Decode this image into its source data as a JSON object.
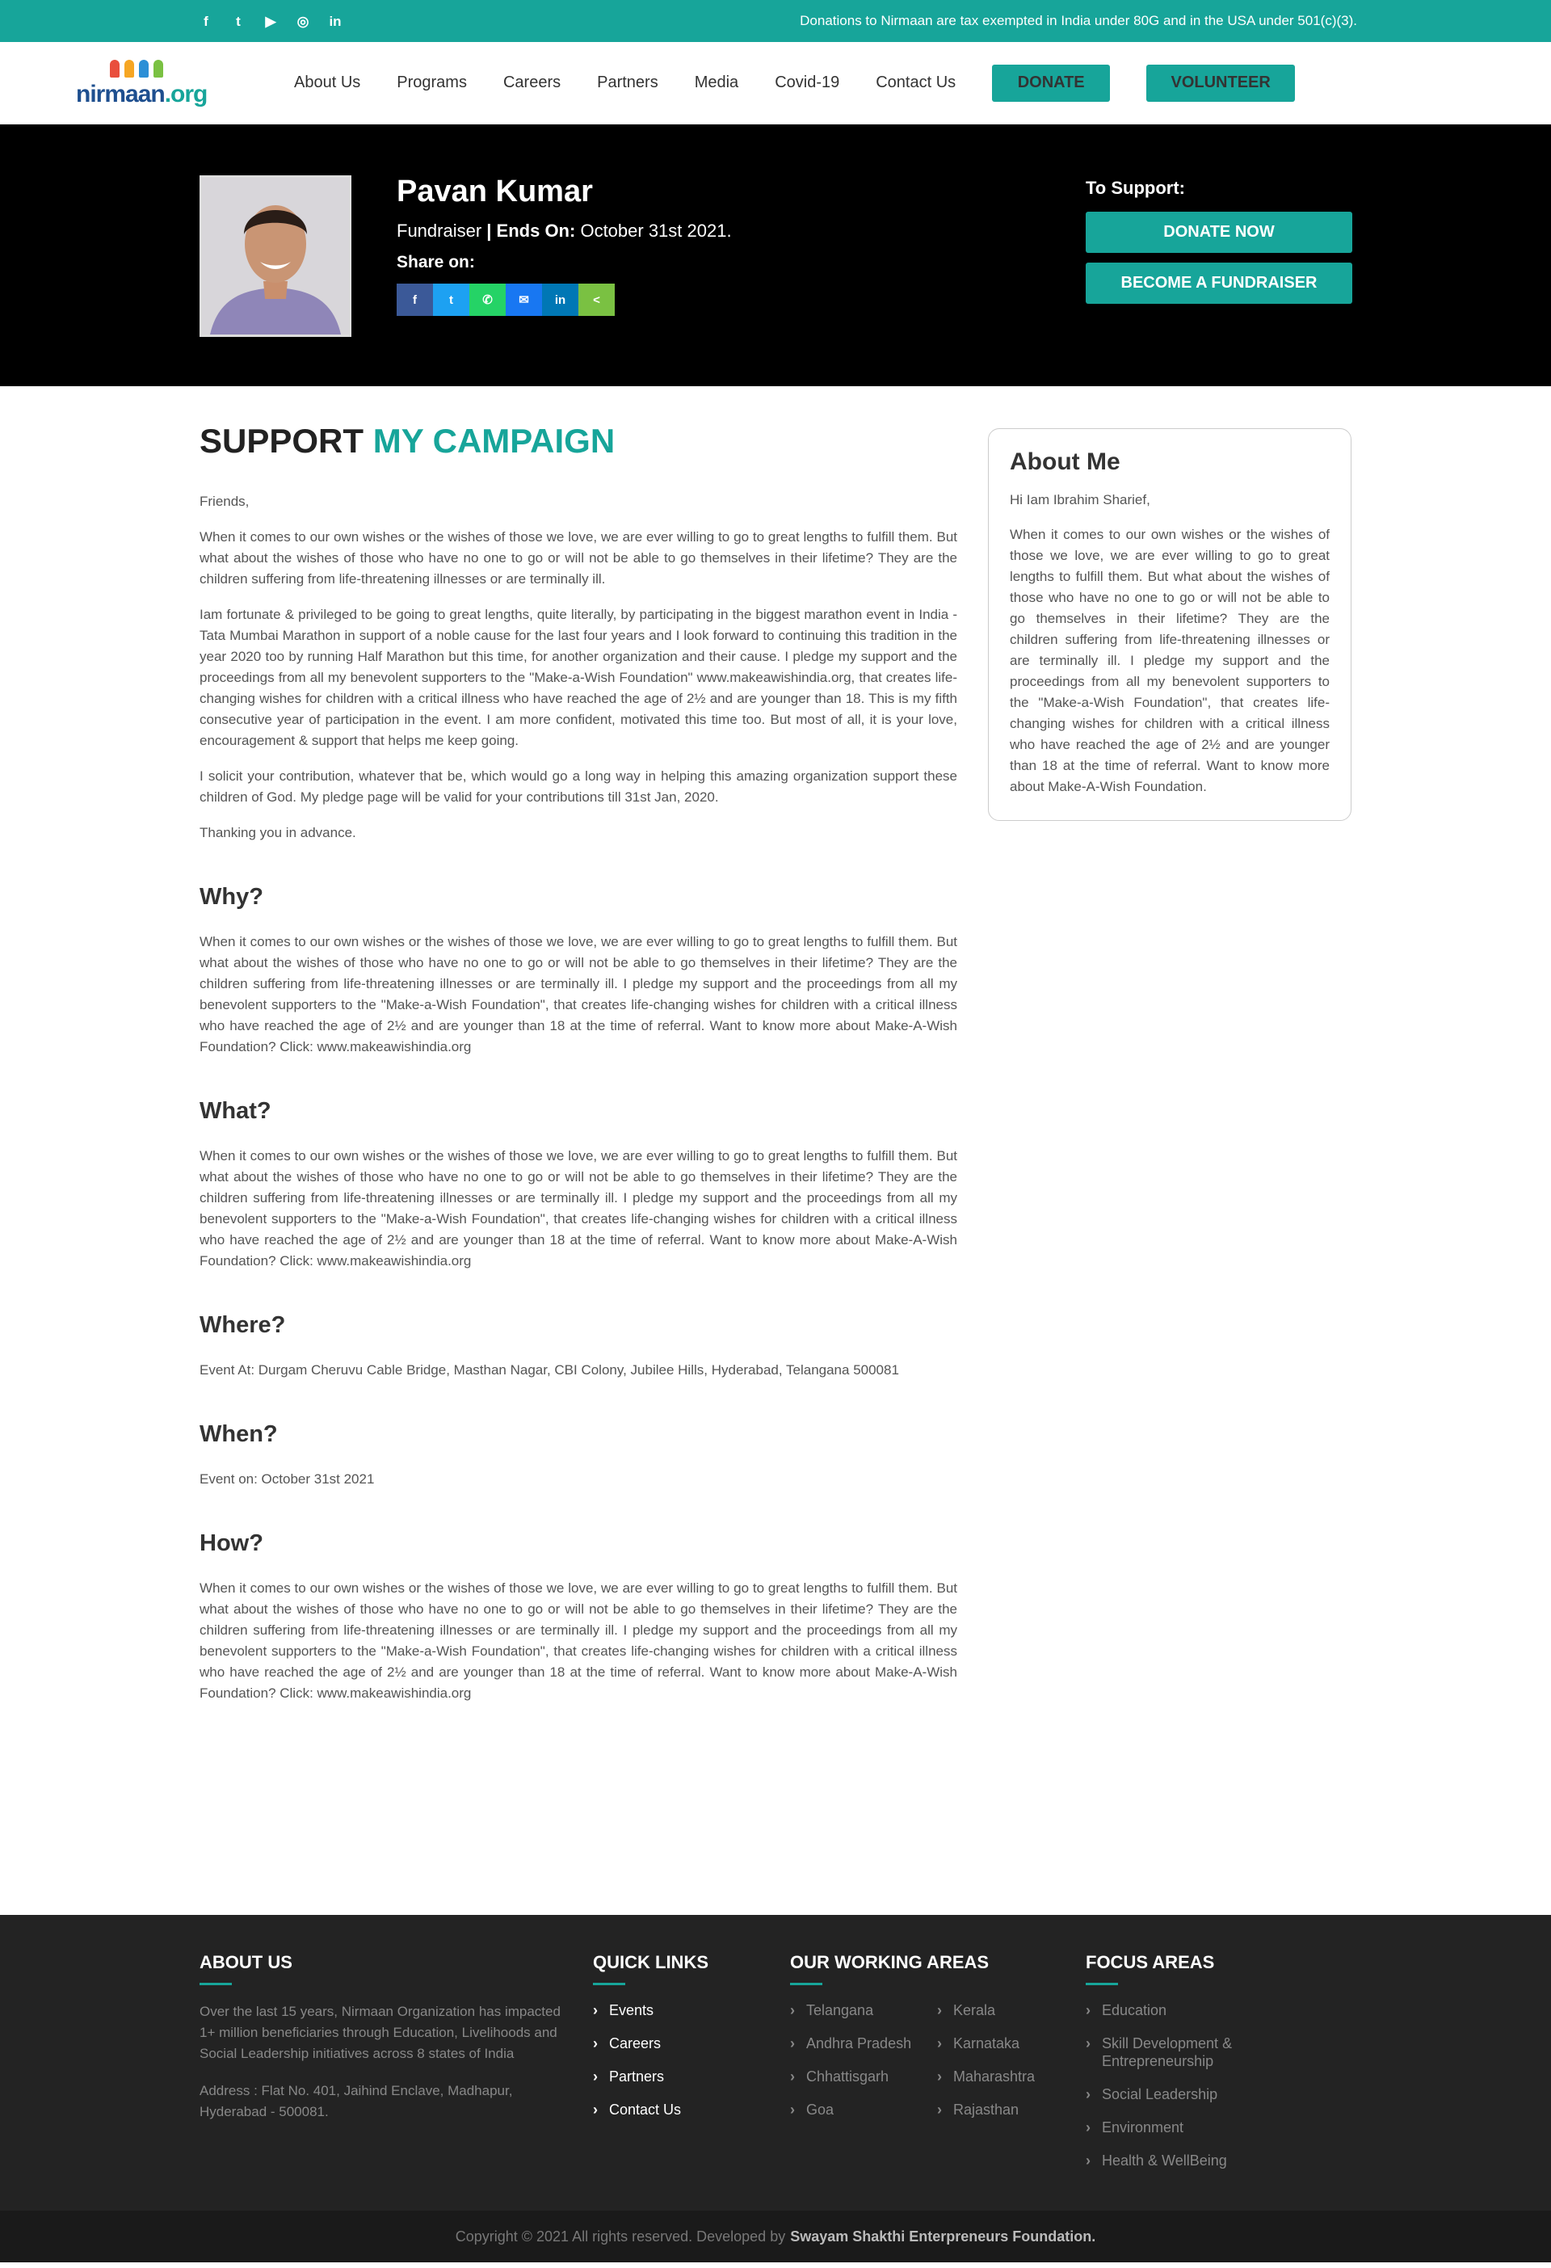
{
  "topbar": {
    "social": [
      {
        "icon": "facebook-icon",
        "glyph": "f"
      },
      {
        "icon": "twitter-icon",
        "glyph": "t"
      },
      {
        "icon": "youtube-icon",
        "glyph": "▶"
      },
      {
        "icon": "instagram-icon",
        "glyph": "◎"
      },
      {
        "icon": "linkedin-icon",
        "glyph": "in"
      }
    ],
    "note": "Donations to Nirmaan are tax exempted in India under 80G and in the USA under 501(c)(3)."
  },
  "header": {
    "logo_main": "nirmaan",
    "logo_suffix": ".org",
    "nav": [
      "About Us",
      "Programs",
      "Careers",
      "Partners",
      "Media",
      "Covid-19",
      "Contact Us"
    ],
    "donate_label": "DONATE",
    "volunteer_label": "VOLUNTEER"
  },
  "hero": {
    "name": "Pavan Kumar",
    "role": "Fundraiser",
    "ends_label": "| Ends On:",
    "ends_date": "October 31st 2021.",
    "share_label": "Share on:",
    "share_buttons": [
      {
        "icon": "facebook-share-icon",
        "glyph": "f",
        "color": "#3b5998"
      },
      {
        "icon": "twitter-share-icon",
        "glyph": "t",
        "color": "#1da1f2"
      },
      {
        "icon": "whatsapp-share-icon",
        "glyph": "✆",
        "color": "#25d366"
      },
      {
        "icon": "messenger-share-icon",
        "glyph": "✉",
        "color": "#1877f2"
      },
      {
        "icon": "linkedin-share-icon",
        "glyph": "in",
        "color": "#0077b5"
      },
      {
        "icon": "share-icon",
        "glyph": "<",
        "color": "#7ac142"
      }
    ],
    "support_label": "To Support:",
    "donate_now_label": "DONATE NOW",
    "fundraiser_label": "BECOME A FUNDRAISER"
  },
  "campaign": {
    "title_plain": "SUPPORT",
    "title_accent": "MY CAMPAIGN",
    "greeting": "Friends,",
    "p1": "When it comes to our own wishes or the wishes of those we love, we are ever willing to go to great lengths to fulfill them. But what about the wishes of those who have no one to go or will not be able to go themselves in their lifetime? They are the children suffering from life-threatening illnesses or are terminally ill.",
    "p2": "Iam fortunate & privileged to be going to great lengths, quite literally, by participating in the biggest marathon event in India -Tata Mumbai Marathon in support of a noble cause for the last four years and I look forward to continuing this tradition in the year 2020 too by running Half Marathon but this time, for another organization and their cause. I pledge my support and the proceedings from all my benevolent supporters to the \"Make-a-Wish Foundation\" www.makeawishindia.org, that creates life-changing wishes for children with a critical illness who have reached the age of 2½ and are younger than 18. This is my fifth consecutive year of participation in the event. I am more confident, motivated this time too. But most of all, it is your love, encouragement & support that helps me keep going.",
    "p3": "I solicit your contribution, whatever that be, which would go a long way in helping this amazing organization support these children of God. My pledge page will be valid for your contributions till 31st Jan, 2020.",
    "p4": "Thanking you in advance.",
    "why_title": "Why?",
    "why_body": "When it comes to our own wishes or the wishes of those we love, we are ever willing to go to great lengths to fulfill them. But what about the wishes of those who have no one to go or will not be able to go themselves in their lifetime? They are the children suffering from life-threatening illnesses or are terminally ill. I pledge my support and the proceedings from all my benevolent supporters to the \"Make-a-Wish Foundation\", that creates life-changing wishes for children with a critical illness who have reached the age of 2½ and are younger than 18 at the time of referral. Want to know more about Make-A-Wish Foundation? Click: www.makeawishindia.org",
    "what_title": "What?",
    "what_body": "When it comes to our own wishes or the wishes of those we love, we are ever willing to go to great lengths to fulfill them. But what about the wishes of those who have no one to go or will not be able to go themselves in their lifetime? They are the children suffering from life-threatening illnesses or are terminally ill. I pledge my support and the proceedings from all my benevolent supporters to the \"Make-a-Wish Foundation\", that creates life-changing wishes for children with a critical illness who have reached the age of 2½ and are younger than 18 at the time of referral. Want to know more about Make-A-Wish Foundation? Click: www.makeawishindia.org",
    "where_title": "Where?",
    "where_body": "Event At: Durgam Cheruvu Cable Bridge, Masthan Nagar, CBI Colony, Jubilee Hills, Hyderabad, Telangana 500081",
    "when_title": "When?",
    "when_body": "Event on: October 31st 2021",
    "how_title": "How?",
    "how_body": "When it comes to our own wishes or the wishes of those we love, we are ever willing to go to great lengths to fulfill them. But what about the wishes of those who have no one to go or will not be able to go themselves in their lifetime? They are the children suffering from life-threatening illnesses or are terminally ill. I pledge my support and the proceedings from all my benevolent supporters to the \"Make-a-Wish Foundation\", that creates life-changing wishes for children with a critical illness who have reached the age of 2½ and are younger than 18 at the time of referral. Want to know more about Make-A-Wish Foundation? Click: www.makeawishindia.org"
  },
  "about_me": {
    "title": "About Me",
    "greeting": "Hi Iam Ibrahim Sharief,",
    "body": "When it comes to our own wishes or the wishes of those we love, we are ever willing to go to great lengths to fulfill them. But what about the wishes of those who have no one to go or will not be able to go themselves in their lifetime? They are the children suffering from life-threatening illnesses or are terminally ill. I pledge my support and the proceedings from all my benevolent supporters to the \"Make-a-Wish Foundation\", that creates life-changing wishes for children with a critical illness who have reached the age of 2½ and are younger than 18 at the time of referral. Want to know more about Make-A-Wish Foundation."
  },
  "footer": {
    "about_title": "ABOUT US",
    "about_text": "Over the last 15 years, Nirmaan Organization has impacted 1+ million beneficiaries through Education, Livelihoods and Social Leadership initiatives across 8 states of India",
    "address": "Address : Flat No. 401, Jaihind Enclave, Madhapur, Hyderabad - 500081.",
    "links_title": "QUICK LINKS",
    "links": [
      "Events",
      "Careers",
      "Partners",
      "Contact Us"
    ],
    "areas_title": "OUR WORKING AREAS",
    "areas_col1": [
      "Telangana",
      "Andhra Pradesh",
      "Chhattisgarh",
      "Goa"
    ],
    "areas_col2": [
      "Kerala",
      "Karnataka",
      "Maharashtra",
      "Rajasthan"
    ],
    "focus_title": "FOCUS AREAS",
    "focus": [
      "Education",
      "Skill Development & Entrepreneurship",
      "Social Leadership",
      "Environment",
      "Health & WellBeing"
    ],
    "copyright": "Copyright © 2021 All rights reserved. Developed by",
    "developer": "Swayam Shakthi Enterpreneurs Foundation."
  },
  "colors": {
    "accent": "#17a59a",
    "hero_bg": "#000000",
    "footer_bg": "#232323"
  }
}
